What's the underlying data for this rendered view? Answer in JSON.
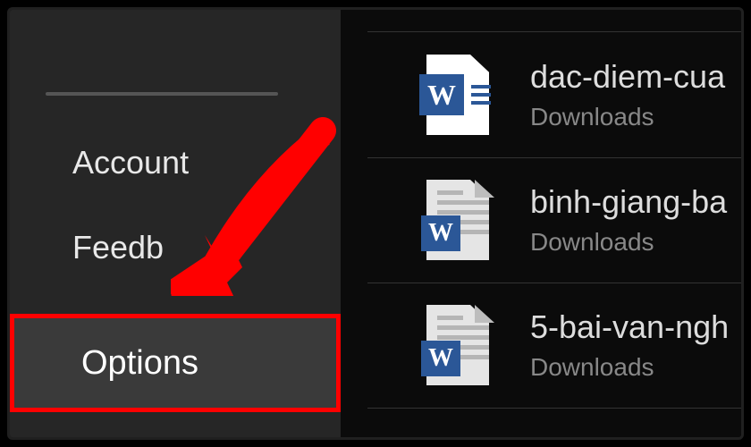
{
  "sidebar": {
    "account_label": "Account",
    "feedback_label": "Feedb",
    "options_label": "Options"
  },
  "files": [
    {
      "name": "dac-diem-cua",
      "location": "Downloads"
    },
    {
      "name": "binh-giang-ba",
      "location": "Downloads"
    },
    {
      "name": "5-bai-van-ngh",
      "location": "Downloads"
    }
  ],
  "icons": {
    "word_badge": "W"
  },
  "annotation": {
    "arrow_color": "#ff0000",
    "highlight_color": "#ff0000"
  }
}
